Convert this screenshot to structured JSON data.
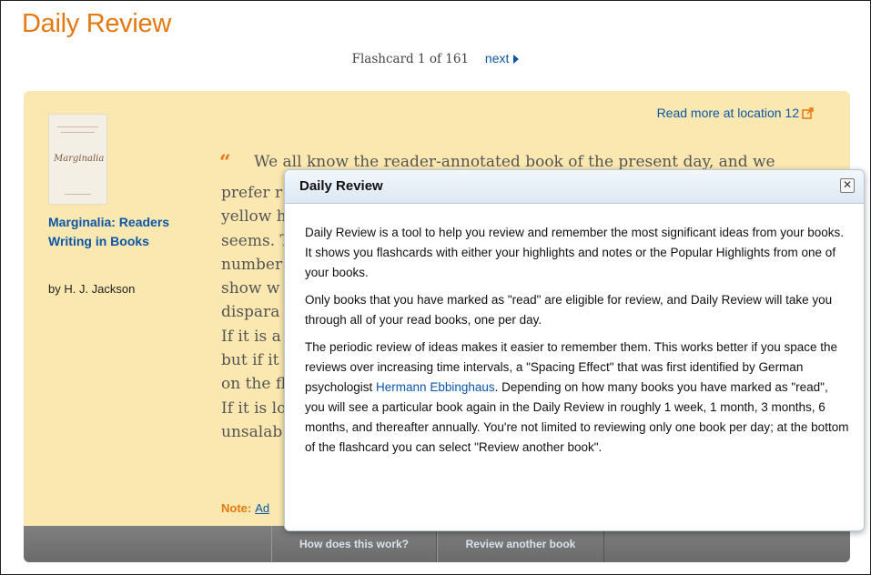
{
  "page": {
    "title": "Daily Review",
    "counter": "Flashcard 1 of 161",
    "next_label": "next"
  },
  "card": {
    "read_more": "Read more at location 12",
    "book": {
      "cover_title": "Marginalia",
      "title": "Marginalia: Readers Writing in Books",
      "author": "by H. J. Jackson"
    },
    "quote_first_line": "We all know the reader-annotated book of the present day, and we",
    "quote_lines": [
      "prefer r",
      "yellow h",
      "seems. T",
      "number",
      "show w",
      "dispara",
      "If it is a",
      "but if it",
      "on the fl",
      "If it is lo",
      "unsalab"
    ],
    "note_label": "Note:",
    "note_link": "Ad"
  },
  "footer": {
    "how_label": "How does this work?",
    "another_label": "Review another book"
  },
  "popup": {
    "title": "Daily Review",
    "close_glyph": "✕",
    "para1": "Daily Review is a tool to help you review and remember the most significant ideas from your books. It shows you flashcards with either your highlights and notes or the Popular Highlights from one of your books.",
    "para2": "Only books that you have marked as \"read\" are eligible for review, and Daily Review will take you through all of your read books, one per day.",
    "para3_before": "The periodic review of ideas makes it easier to remember them. This works better if you space the reviews over increasing time intervals, a \"Spacing Effect\" that was first identified by German psychologist ",
    "para3_link": "Hermann Ebbinghaus",
    "para3_after": ". Depending on how many books you have marked as \"read\", you will see a particular book again in the Daily Review in roughly 1 week, 1 month, 3 months, 6 months, and thereafter annually. You're not limited to reviewing only one book per day; at the bottom of the flashcard you can select \"Review another book\"."
  },
  "colors": {
    "accent_orange": "#e47911",
    "link_blue": "#0b55a8",
    "card_bg": "#fbe8b0",
    "footer_bg": "#777777"
  }
}
